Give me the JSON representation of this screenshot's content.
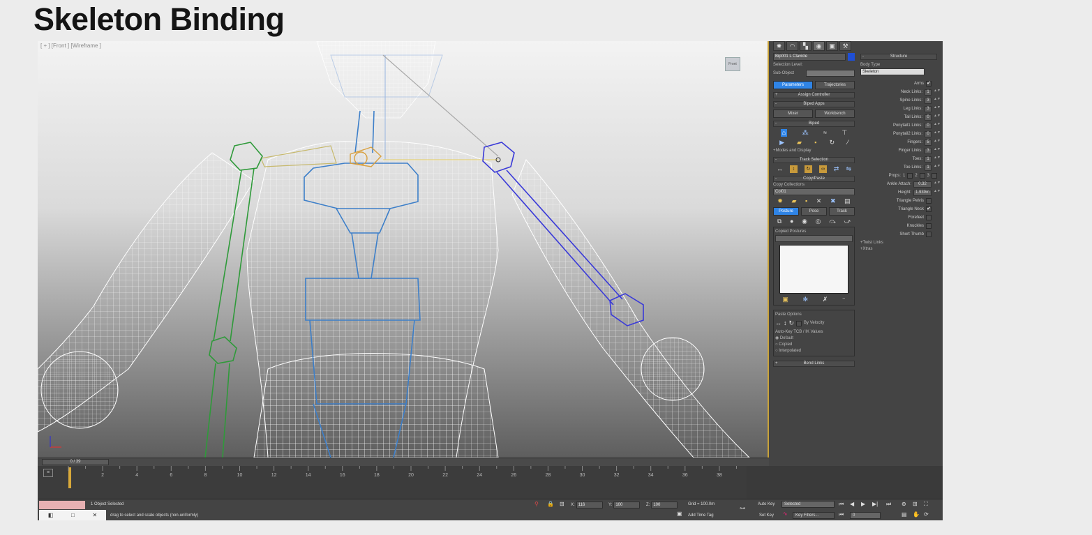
{
  "slide": {
    "title": "Skeleton Binding"
  },
  "viewport": {
    "label": "[ + ] [Front ] [Wireframe ]",
    "viewcube_label": "Front"
  },
  "command_panel": {
    "tabs": [
      "create-icon",
      "modify-icon",
      "hierarchy-icon",
      "motion-icon",
      "display-icon",
      "utilities-icon"
    ],
    "object_name": "Bip001 L Clavicle",
    "object_color": "#1f4fd6",
    "selection_level_label": "Selection Level:",
    "sub_object_label": "Sub-Object",
    "parameters_button": "Parameters",
    "trajectories_button": "Trajectories",
    "assign_controller": "Assign Controller",
    "biped_apps": "Biped Apps",
    "mixer_button": "Mixer",
    "workbench_button": "Workbench",
    "biped_rollout": "Biped",
    "modes_and_display": "+Modes and Display",
    "track_selection": "Track Selection",
    "copy_paste": "Copy/Paste",
    "copy_collections_label": "Copy Collections",
    "collection_value": "Col01",
    "posture_tab": "Posture",
    "pose_tab": "Pose",
    "track_tab": "Track",
    "copied_postures_label": "Copied Postures",
    "paste_options_label": "Paste Options",
    "by_velocity_label": "By Velocity",
    "auto_key_tcb_label": "Auto-Key TCB / IK Values",
    "radio_default": "Default",
    "radio_copied": "Copied",
    "radio_interpolated": "Interpolated",
    "bend_links": "Bend Links",
    "structure": {
      "header": "Structure",
      "body_type_label": "Body Type",
      "body_type_value": "Skeleton",
      "rows": [
        {
          "label": "Arms",
          "kind": "check",
          "value": "✔"
        },
        {
          "label": "Neck Links:",
          "kind": "num",
          "value": "1"
        },
        {
          "label": "Spine Links:",
          "kind": "num",
          "value": "3"
        },
        {
          "label": "Leg Links:",
          "kind": "num",
          "value": "3"
        },
        {
          "label": "Tail Links:",
          "kind": "num",
          "value": "0"
        },
        {
          "label": "Ponytail1 Links:",
          "kind": "num",
          "value": "0"
        },
        {
          "label": "Ponytail2 Links:",
          "kind": "num",
          "value": "0"
        },
        {
          "label": "Fingers:",
          "kind": "num",
          "value": "5"
        },
        {
          "label": "Finger Links:",
          "kind": "num",
          "value": "3"
        },
        {
          "label": "Toes:",
          "kind": "num",
          "value": "1"
        },
        {
          "label": "Toe Links:",
          "kind": "num",
          "value": "1"
        }
      ],
      "props_label": "Props:",
      "props": [
        "1",
        "2",
        "3"
      ],
      "ankle_attach_label": "Ankle Attach:",
      "ankle_attach_value": "0.32",
      "height_label": "Height:",
      "height_value": "1.939m",
      "checks": [
        {
          "label": "Triangle Pelvis",
          "value": ""
        },
        {
          "label": "Triangle Neck",
          "value": "✔"
        },
        {
          "label": "Forefeet",
          "value": ""
        },
        {
          "label": "Knuckles",
          "value": ""
        },
        {
          "label": "Short Thumb",
          "value": ""
        }
      ],
      "twist_links": "+Twist Links",
      "xtras": "+Xtras"
    }
  },
  "timeline": {
    "slider_label": "0 / 39",
    "ticks": [
      "2",
      "4",
      "6",
      "8",
      "10",
      "12",
      "14",
      "16",
      "18",
      "20",
      "22",
      "24",
      "26",
      "28",
      "30",
      "32",
      "34",
      "36",
      "38"
    ]
  },
  "status": {
    "selection": "1 Object Selected",
    "prompt": "drag to select and scale objects (non-uniformly)",
    "x_label": "X:",
    "x_value": "116",
    "y_label": "Y:",
    "y_value": "100",
    "z_label": "Z:",
    "z_value": "100",
    "grid": "Grid = 100.0m",
    "add_time_tag": "Add Time Tag",
    "auto_key": "Auto Key",
    "selected_value": "Selected",
    "set_key": "Set Key",
    "key_filters": "Key Filters...",
    "frame_value": "0"
  }
}
